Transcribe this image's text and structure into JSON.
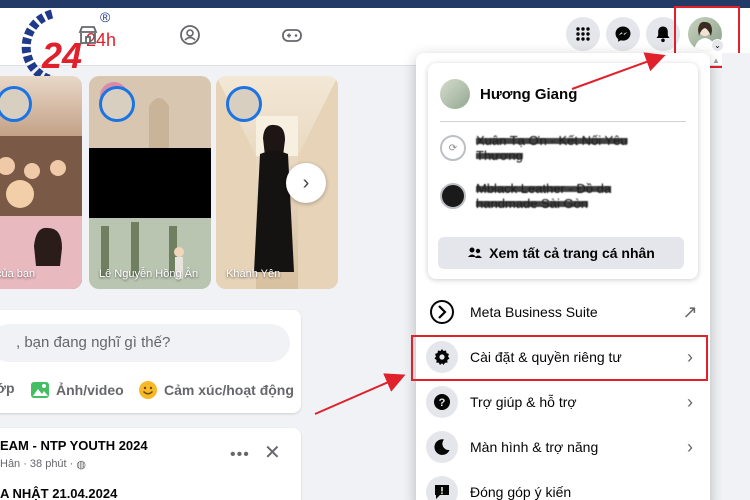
{
  "header": {
    "icons": [
      "marketplace-icon",
      "groups-icon",
      "gaming-icon",
      "menu-grid-icon",
      "messenger-icon",
      "notifications-icon"
    ],
    "logo_text": "24h",
    "logo_mark": "®"
  },
  "stories": [
    {
      "name": "của bạn"
    },
    {
      "name": "Lê Nguyễn Hồng Ân"
    },
    {
      "name": "Khánh Yên"
    }
  ],
  "composer": {
    "placeholder": ", bạn đang nghĩ gì thế?",
    "actions": [
      {
        "label": "ớp",
        "icon": "video-icon"
      },
      {
        "label": "Ảnh/video",
        "icon": "photo-icon"
      },
      {
        "label": "Cảm xúc/hoạt động",
        "icon": "feeling-icon"
      }
    ]
  },
  "post": {
    "title": "EAM - NTP YOUTH 2024",
    "author": "Hân",
    "time": "· 38 phút ·",
    "body": "A NHẬT 21.04.2024"
  },
  "account_menu": {
    "profile_name": "Hương Giang",
    "pages": [
      {
        "name": "Xuân Tạ Ơn - Kết Nối Yêu Thương"
      },
      {
        "name": "Mblack Leather - Đồ da handmade Sài Gòn"
      }
    ],
    "see_all_label": "Xem tất cả trang cá nhân",
    "items": [
      {
        "label": "Meta Business Suite",
        "icon": "meta-business-icon"
      },
      {
        "label": "Cài đặt & quyền riêng tư",
        "icon": "gear-icon"
      },
      {
        "label": "Trợ giúp & hỗ trợ",
        "icon": "help-icon"
      },
      {
        "label": "Màn hình & trợ năng",
        "icon": "moon-icon"
      },
      {
        "label": "Đóng góp ý kiến",
        "icon": "feedback-icon"
      }
    ]
  },
  "colors": {
    "accent": "#1b74e4",
    "annotation": "#e0202a",
    "logo": "#1f3a8a"
  }
}
